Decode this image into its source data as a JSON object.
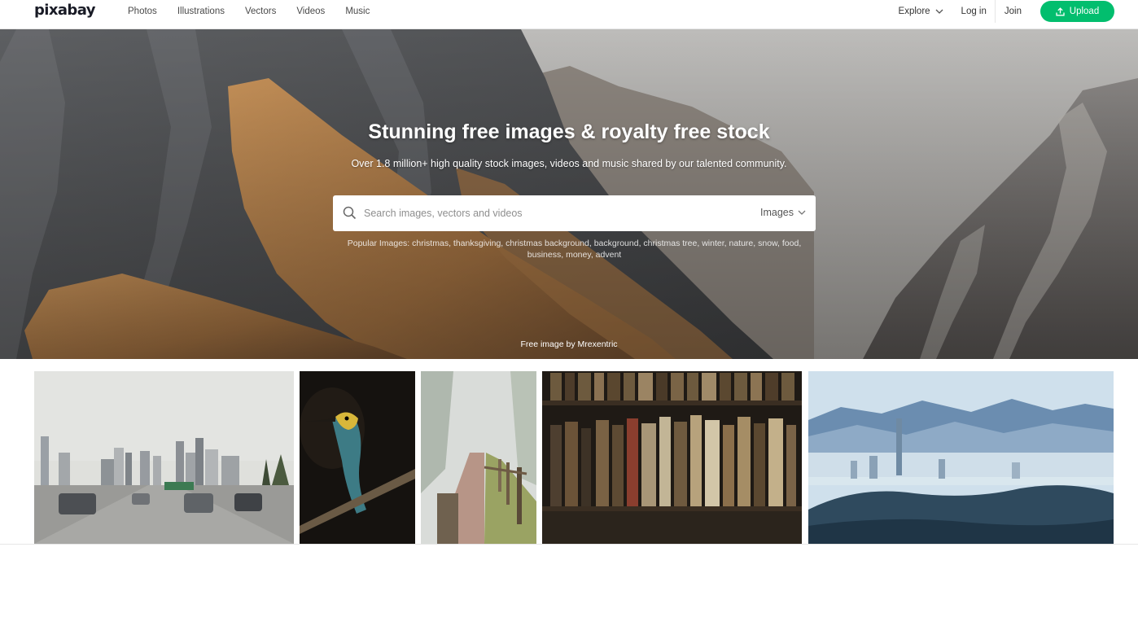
{
  "brand": {
    "logo_text": "pixabay",
    "accent_color": "#02be6e"
  },
  "nav": {
    "links": [
      "Photos",
      "Illustrations",
      "Vectors",
      "Videos",
      "Music"
    ],
    "explore_label": "Explore",
    "login_label": "Log in",
    "join_label": "Join",
    "upload_label": "Upload",
    "icons": {
      "explore": "chevron-down-icon",
      "upload": "upload-icon"
    }
  },
  "hero": {
    "title": "Stunning free images & royalty free stock",
    "subtitle": "Over 1.8 million+ high quality stock images, videos and music shared by our talented community.",
    "search": {
      "placeholder": "Search images, vectors and videos",
      "value": "",
      "type_selected": "Images",
      "icon": "search-icon"
    },
    "popular": {
      "prefix": "Popular Images:",
      "tags": [
        "christmas",
        "thanksgiving",
        "christmas background",
        "background",
        "christmas tree",
        "winter",
        "nature",
        "snow",
        "food",
        "business",
        "money",
        "advent"
      ]
    },
    "credit_prefix": "Free image by",
    "credit_author": "Mrexentric"
  },
  "gallery": {
    "items": [
      {
        "subject": "city highway skyline"
      },
      {
        "subject": "bee-eater bird on branch"
      },
      {
        "subject": "foggy path with fence"
      },
      {
        "subject": "old books on shelf"
      },
      {
        "subject": "misty city skyline mountains"
      }
    ]
  }
}
